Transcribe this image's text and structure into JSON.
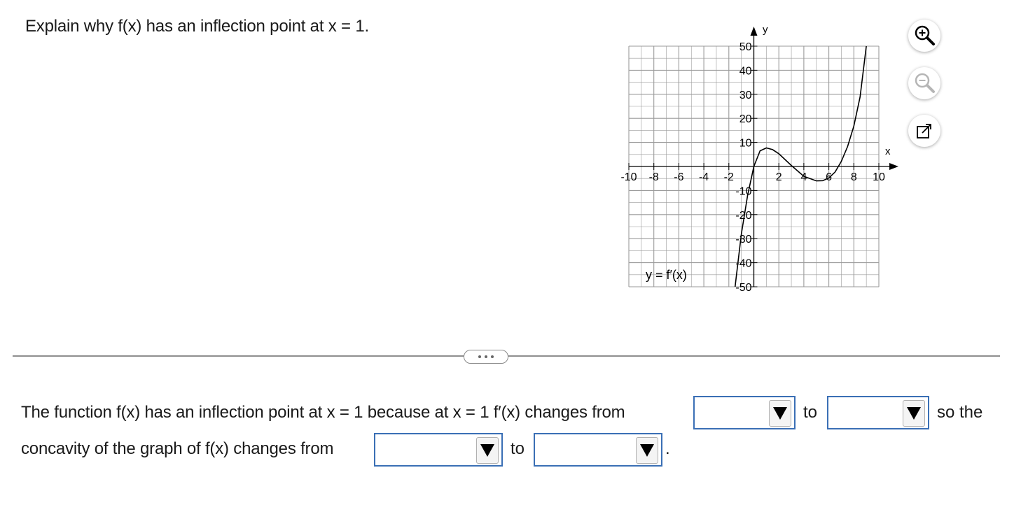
{
  "question": "Explain why f(x) has an inflection point at x = 1.",
  "graph": {
    "function_label": "y = f′(x)",
    "x_axis_name": "x",
    "y_axis_name": "y",
    "x_tick_labels": [
      "-10",
      "-8",
      "-6",
      "-4",
      "-2",
      "2",
      "4",
      "6",
      "8",
      "10"
    ],
    "y_tick_labels": [
      "50",
      "40",
      "30",
      "20",
      "10",
      "-10",
      "-20",
      "-30",
      "-40",
      "-50"
    ]
  },
  "chart_data": {
    "type": "line",
    "xlim": [
      -10,
      10
    ],
    "ylim": [
      -50,
      50
    ],
    "grid": true,
    "series": [
      {
        "name": "y = f′(x)",
        "x": [
          -1.5,
          -1,
          -0.5,
          0,
          0.5,
          1,
          1.5,
          2,
          3,
          4,
          5,
          5.5,
          6,
          6.5,
          7,
          7.5,
          8,
          8.5,
          9
        ],
        "y": [
          -50,
          -28,
          -12,
          0,
          6.5,
          7.7,
          7,
          5.3,
          0.4,
          -4.1,
          -6,
          -5.9,
          -4.8,
          -2.3,
          2.1,
          8.3,
          16.8,
          28.9,
          50
        ]
      }
    ]
  },
  "tools": {
    "zoom_in": "zoom-in-icon",
    "zoom_out": "zoom-out-icon",
    "popout": "popout-icon"
  },
  "answer": {
    "line1_text": "The function f(x) has an inflection point at x = 1 because at x = 1 f′(x) changes from",
    "to1": "to",
    "so_the": "so the",
    "line2_text": "concavity of the graph of f(x) changes from",
    "to2": "to",
    "period": ".",
    "dropdown1_value": "",
    "dropdown2_value": "",
    "dropdown3_value": "",
    "dropdown4_value": ""
  },
  "colors": {
    "dropdown_border": "#3a6fb5",
    "grid": "#9a9a9a"
  }
}
